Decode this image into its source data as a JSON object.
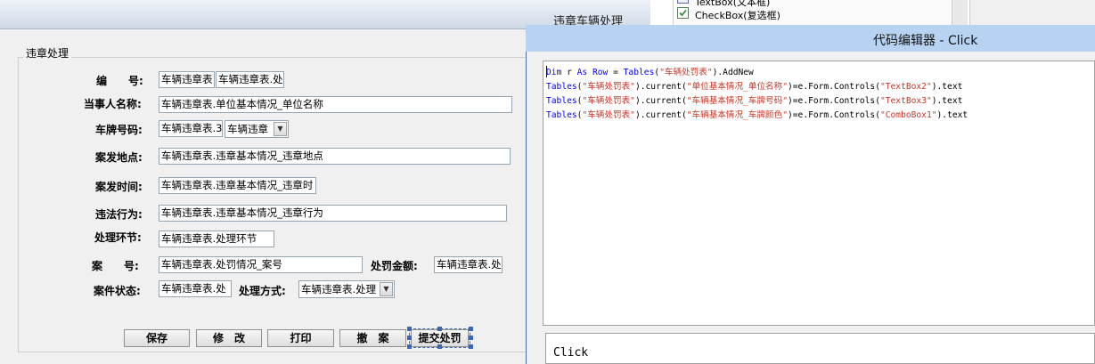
{
  "designer": {
    "title": "违章车辆处理",
    "group_title": "违章处理",
    "fields": {
      "id_label": "编　　号:",
      "id_value_1": "车辆违章表",
      "id_value_2": "车辆违章表.处",
      "party_label": "当事人名称:",
      "party_value": "车辆违章表.单位基本情况_单位名称",
      "plate_label": "车牌号码:",
      "plate_value_1": "车辆违章表.3",
      "plate_value_2": "车辆违章",
      "place_label": "案发地点:",
      "place_value": "车辆违章表.违章基本情况_违章地点",
      "time_label": "案发时间:",
      "time_value": "车辆违章表.违章基本情况_违章时",
      "behavior_label": "违法行为:",
      "behavior_value": "车辆违章表.违章基本情况_违章行为",
      "stage_label": "处理环节:",
      "stage_value": "车辆违章表.处理环节",
      "case_label": "案　　号:",
      "case_value": "车辆违章表.处罚情况_案号",
      "amount_label": "处罚金额:",
      "amount_value": "车辆违章表.处",
      "status_label": "案件状态:",
      "status_value": "车辆违章表.处",
      "method_label": "处理方式:",
      "method_value": "车辆违章表.处理"
    },
    "buttons": {
      "save": "保存",
      "modify": "修　改",
      "print": "打印",
      "cancel": "撤　案",
      "submit": "提交处罚"
    }
  },
  "toolbox": {
    "item_textbox": "TextBox(文本框)",
    "item_checkbox": "CheckBox(复选框)"
  },
  "editor": {
    "title": "代码编辑器 - Click",
    "event_name": "Click",
    "code": [
      [
        [
          "kw",
          "Dim"
        ],
        [
          "pl",
          " r "
        ],
        [
          "kw",
          "As"
        ],
        [
          "pl",
          " "
        ],
        [
          "kw",
          "Row"
        ],
        [
          "pl",
          " = "
        ],
        [
          "kw",
          "Tables"
        ],
        [
          "pl",
          "("
        ],
        [
          "st",
          "\"车辆处罚表\""
        ],
        [
          "pl",
          ").AddNew"
        ]
      ],
      [
        [
          "kw",
          "Tables"
        ],
        [
          "pl",
          "("
        ],
        [
          "st",
          "\"车辆处罚表\""
        ],
        [
          "pl",
          ").current("
        ],
        [
          "st",
          "\"单位基本情况_单位名称\""
        ],
        [
          "pl",
          ")=e.Form.Controls("
        ],
        [
          "st",
          "\"TextBox2\""
        ],
        [
          "pl",
          ").text"
        ]
      ],
      [
        [
          "kw",
          "Tables"
        ],
        [
          "pl",
          "("
        ],
        [
          "st",
          "\"车辆处罚表\""
        ],
        [
          "pl",
          ").current("
        ],
        [
          "st",
          "\"车辆基本情况_车牌号码\""
        ],
        [
          "pl",
          ")=e.Form.Controls("
        ],
        [
          "st",
          "\"TextBox3\""
        ],
        [
          "pl",
          ").text"
        ]
      ],
      [
        [
          "kw",
          "Tables"
        ],
        [
          "pl",
          "("
        ],
        [
          "st",
          "\"车辆处罚表\""
        ],
        [
          "pl",
          ").current("
        ],
        [
          "st",
          "\"车辆基本情况_车牌颜色\""
        ],
        [
          "pl",
          ")=e.Form.Controls("
        ],
        [
          "st",
          "\"ComboBox1\""
        ],
        [
          "pl",
          ").text"
        ]
      ]
    ]
  }
}
